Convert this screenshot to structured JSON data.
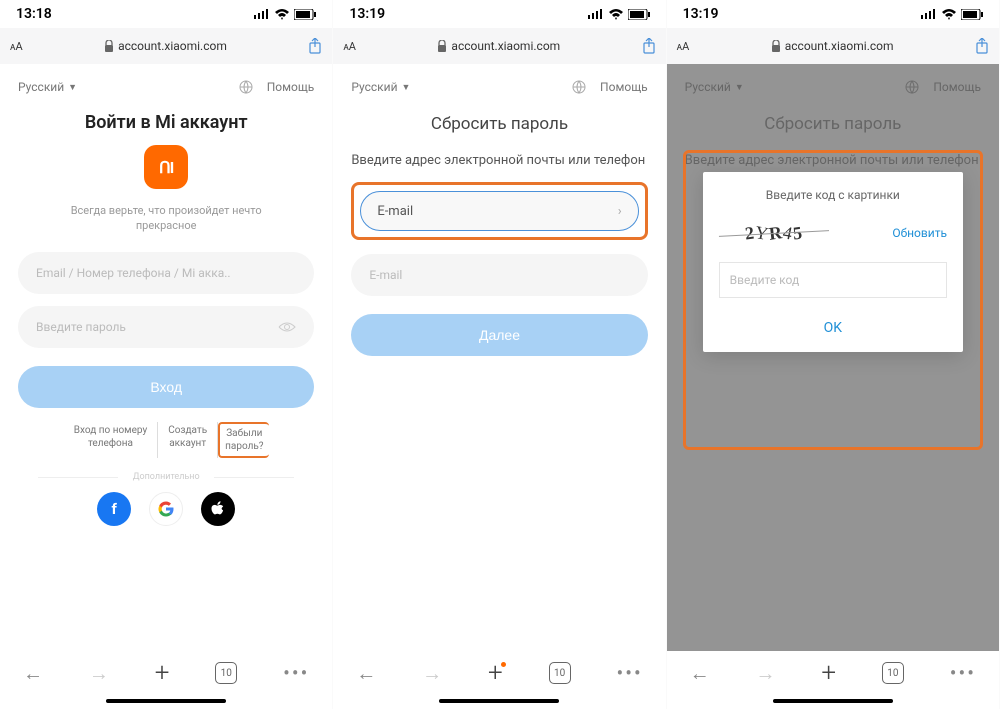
{
  "screens": [
    {
      "time": "13:18",
      "url": "account.xiaomi.com",
      "language": "Русский",
      "help": "Помощь",
      "title": "Войти в Mi аккаунт",
      "tagline1": "Всегда верьте, что произойдет нечто",
      "tagline2": "прекрасное",
      "login_placeholder": "Email / Номер телефона / Mi акка..",
      "password_placeholder": "Введите пароль",
      "signin": "Вход",
      "link_phone1": "Вход по номеру",
      "link_phone2": "телефона",
      "link_create1": "Создать",
      "link_create2": "аккаунт",
      "link_forgot1": "Забыли",
      "link_forgot2": "пароль?",
      "extra": "Дополнительно",
      "tabs": "10"
    },
    {
      "time": "13:19",
      "url": "account.xiaomi.com",
      "language": "Русский",
      "help": "Помощь",
      "title": "Сбросить пароль",
      "instruction": "Введите адрес электронной почты или телефон",
      "select_label": "E-mail",
      "email_placeholder": "E-mail",
      "next": "Далее",
      "tabs": "10"
    },
    {
      "time": "13:19",
      "url": "account.xiaomi.com",
      "language": "Русский",
      "help": "Помощь",
      "title": "Сбросить пароль",
      "instruction": "Введите адрес электронной почты или телефон",
      "modal_title": "Введите код с картинки",
      "captcha": [
        "2",
        "Y",
        "R",
        "4",
        "5"
      ],
      "refresh": "Обновить",
      "code_placeholder": "Введите код",
      "ok": "OK",
      "tabs": "10"
    }
  ]
}
